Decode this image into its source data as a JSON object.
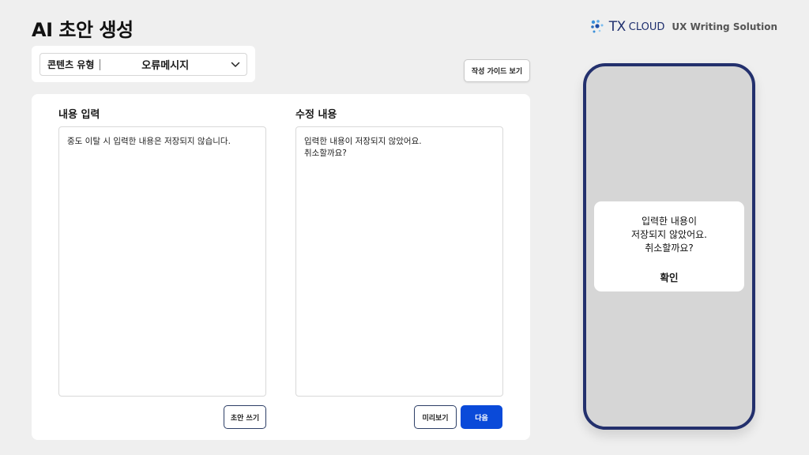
{
  "header": {
    "title": "AI 초안 생성",
    "brand": {
      "tx": "TX",
      "cloud": "CLOUD",
      "subtitle": "UX Writing Solution"
    }
  },
  "content_type": {
    "label": "콘텐츠 유형",
    "selected": "오류메시지"
  },
  "guide_button": "작성 가이드 보기",
  "input_panel": {
    "title": "내용 입력",
    "text": "중도 이탈 시 입력한 내용은 저장되지 않습니다.",
    "draft_button": "초안 쓰기"
  },
  "output_panel": {
    "title": "수정 내용",
    "text": "입력한 내용이 저장되지 않았어요.\n취소할까요?",
    "preview_button": "미리보기",
    "next_button": "다음"
  },
  "preview_dialog": {
    "message": "입력한 내용이\n저장되지 않았어요.\n취소할까요?",
    "confirm": "확인"
  },
  "colors": {
    "primary": "#0a4ad9",
    "phone_frame": "#23306d",
    "brand": "#1f2f6e"
  }
}
